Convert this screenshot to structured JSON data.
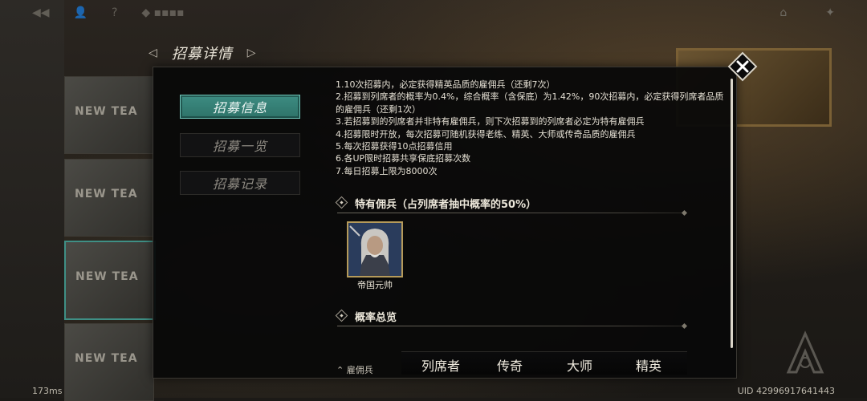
{
  "header": {
    "title": "招募详情"
  },
  "tabs": [
    {
      "label": "招募信息",
      "active": true
    },
    {
      "label": "招募一览",
      "active": false
    },
    {
      "label": "招募记录",
      "active": false
    }
  ],
  "rules": [
    "1.10次招募内，必定获得精英品质的雇佣兵（还剩7次）",
    "2.招募到列席者的概率为0.4%，综合概率（含保底）为1.42%，90次招募内，必定获得列席者品质的雇佣兵（还剩1次）",
    "3.若招募到的列席者并非特有雇佣兵，则下次招募到的列席者必定为特有雇佣兵",
    "4.招募限时开放，每次招募可随机获得老练、精英、大师或传奇品质的雇佣兵",
    "5.每次招募获得10点招募信用",
    "6.各UP限时招募共享保底招募次数",
    "7.每日招募上限为8000次"
  ],
  "sections": {
    "special": "特有佣兵（占列席者抽中概率的50%）",
    "overview": "概率总览"
  },
  "hero": {
    "name": "帝国元帅"
  },
  "table": {
    "columns": [
      "列席者",
      "传奇",
      "大师",
      "精英"
    ],
    "partial_row_label": "⌃ 雇佣兵"
  },
  "background_cards": [
    "NEW TEA",
    "NEW TEA",
    "NEW TEA",
    "NEW TEA"
  ],
  "footer": {
    "fps": "173ms",
    "uid": "UID 42996917641443"
  },
  "colors": {
    "accent": "#3d8c82",
    "panel": "#080809",
    "gold": "#b59a5a"
  }
}
